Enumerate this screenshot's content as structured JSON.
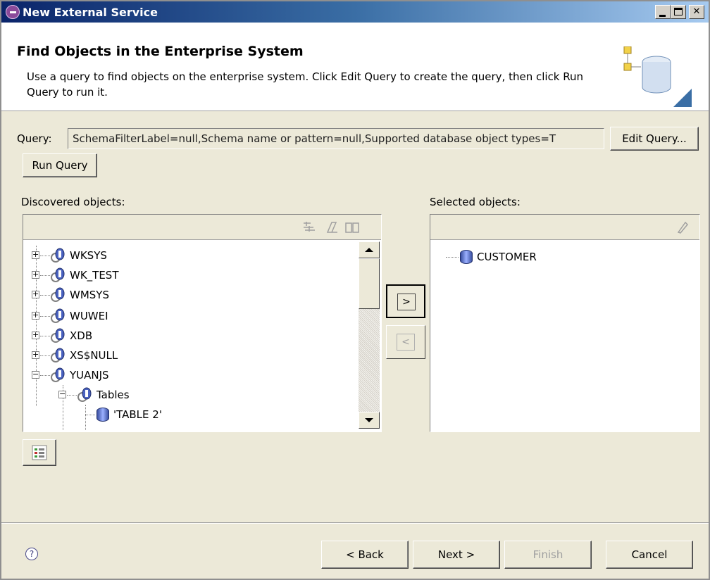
{
  "window": {
    "title": "New External Service"
  },
  "header": {
    "heading": "Find Objects in the Enterprise System",
    "description": "Use a query to find objects on the enterprise system.  Click Edit Query to create the query, then click Run Query to run it."
  },
  "query": {
    "label": "Query:",
    "value": "SchemaFilterLabel=null,Schema name or pattern=null,Supported database object types=T",
    "edit_button": "Edit Query...",
    "run_button": "Run Query"
  },
  "discovered": {
    "label": "Discovered objects:",
    "items": [
      {
        "label": "WKSYS"
      },
      {
        "label": "WK_TEST"
      },
      {
        "label": "WMSYS"
      },
      {
        "label": "WUWEI"
      },
      {
        "label": "XDB"
      },
      {
        "label": "XS$NULL"
      },
      {
        "label": "YUANJS"
      },
      {
        "label": "Tables"
      },
      {
        "label": "'TABLE 2'"
      }
    ]
  },
  "selected": {
    "label": "Selected objects:",
    "items": [
      {
        "label": "CUSTOMER"
      }
    ]
  },
  "move": {
    "add": ">",
    "remove": "<"
  },
  "footer": {
    "help": "?",
    "back": "< Back",
    "next": "Next >",
    "finish": "Finish",
    "cancel": "Cancel"
  },
  "colors": {
    "titlebar_start": "#0a246a",
    "titlebar_end": "#a6caf0",
    "dialog_bg": "#ece9d8",
    "disabled_text": "#a0a0a0"
  }
}
